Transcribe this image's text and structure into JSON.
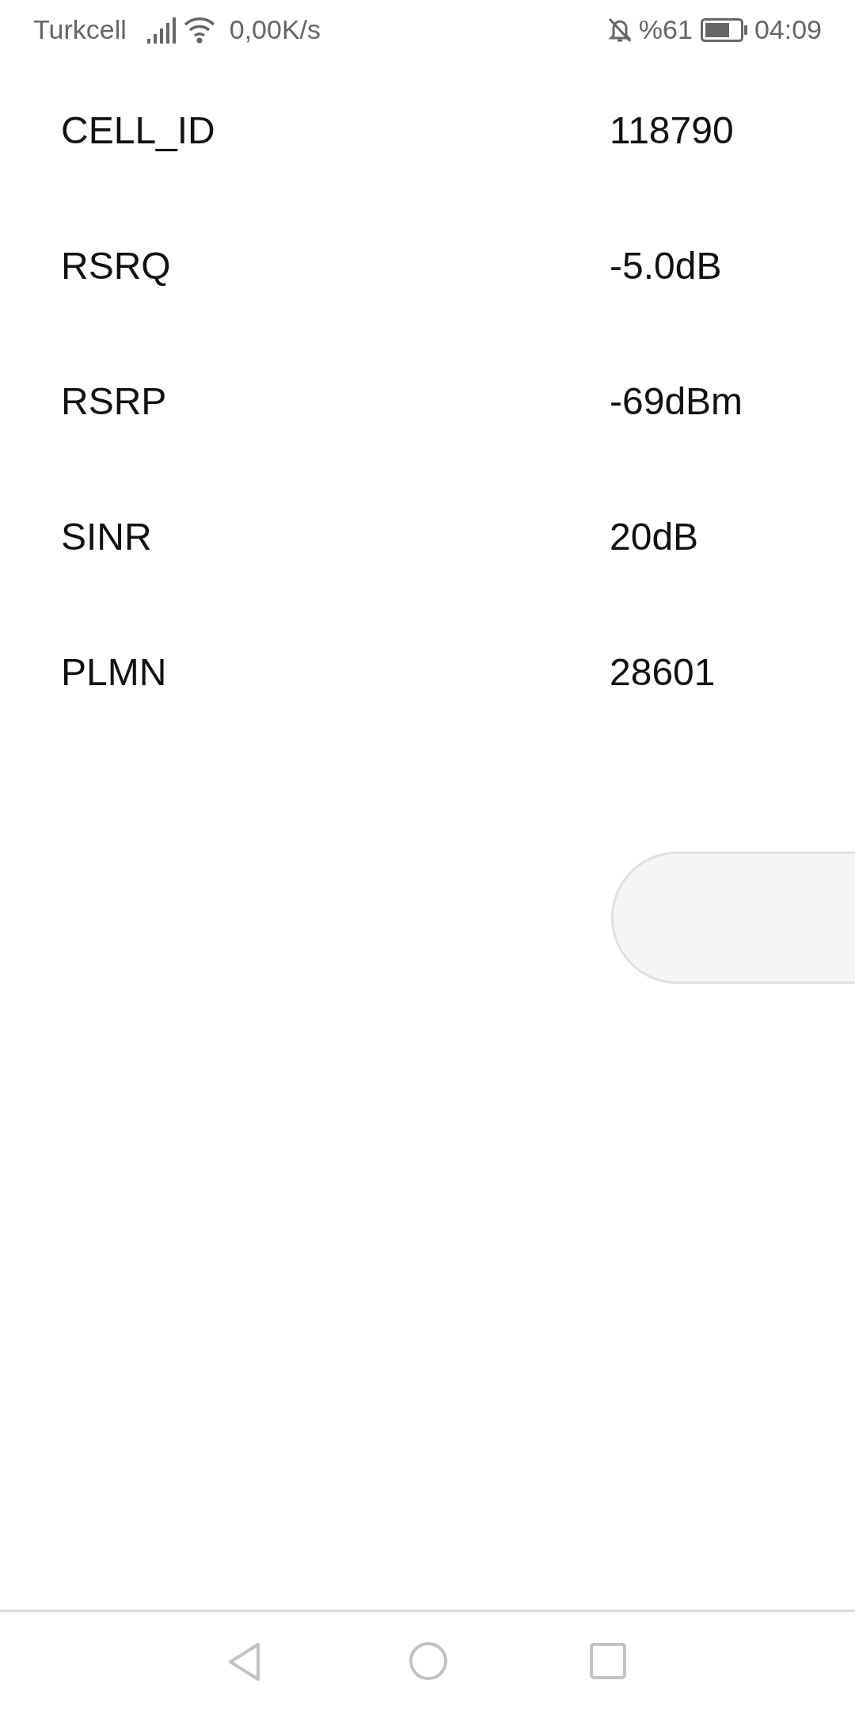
{
  "status_bar": {
    "carrier": "Turkcell",
    "speed": "0,00K/s",
    "battery": "%61",
    "time": "04:09"
  },
  "rows": [
    {
      "label": "CELL_ID",
      "value": "118790"
    },
    {
      "label": "RSRQ",
      "value": "-5.0dB"
    },
    {
      "label": "RSRP",
      "value": "-69dBm"
    },
    {
      "label": "SINR",
      "value": "20dB"
    },
    {
      "label": "PLMN",
      "value": "28601"
    }
  ]
}
